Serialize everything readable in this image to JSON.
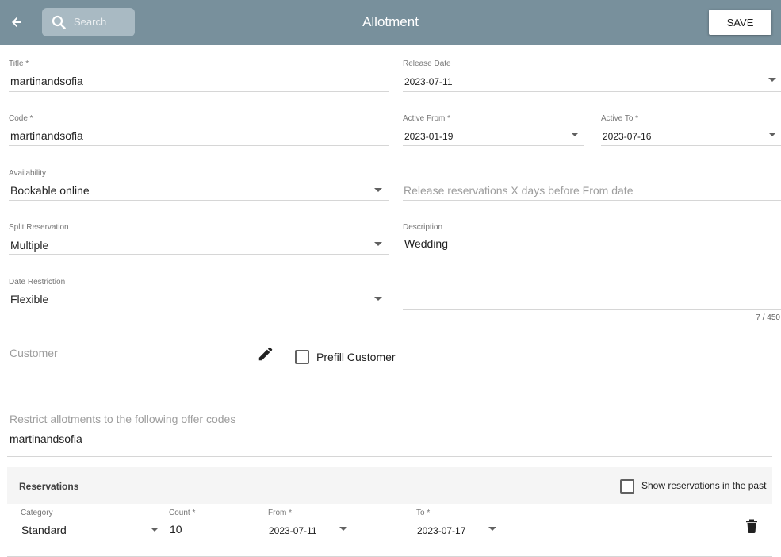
{
  "header": {
    "title": "Allotment",
    "search_placeholder": "Search",
    "save_label": "SAVE",
    "bar_color": "#78909c"
  },
  "form": {
    "title": {
      "label": "Title *",
      "value": "martinandsofia"
    },
    "release_date": {
      "label": "Release Date",
      "value": "2023-07-11"
    },
    "code": {
      "label": "Code *",
      "value": "martinandsofia"
    },
    "active_from": {
      "label": "Active From *",
      "value": "2023-01-19"
    },
    "active_to": {
      "label": "Active To *",
      "value": "2023-07-16"
    },
    "availability": {
      "label": "Availability",
      "value": "Bookable online"
    },
    "release_days": {
      "placeholder": "Release reservations X days before From date"
    },
    "split_reservation": {
      "label": "Split Reservation",
      "value": "Multiple"
    },
    "description": {
      "label": "Description",
      "value": "Wedding",
      "counter": "7 / 450"
    },
    "date_restriction": {
      "label": "Date Restriction",
      "value": "Flexible"
    },
    "customer": {
      "placeholder": "Customer"
    },
    "prefill_customer": {
      "label": "Prefill Customer",
      "checked": false
    },
    "offer_codes": {
      "placeholder": "Restrict allotments to the following offer codes",
      "value": "martinandsofia"
    }
  },
  "reservations": {
    "title": "Reservations",
    "show_past_label": "Show reservations in the past",
    "show_past_checked": false,
    "rows": [
      {
        "category_label": "Category",
        "category": "Standard",
        "count_label": "Count *",
        "count": "10",
        "from_label": "From *",
        "from": "2023-07-11",
        "to_label": "To *",
        "to": "2023-07-17"
      }
    ]
  },
  "icons": [
    "arrow-back-icon",
    "search-icon",
    "pencil-icon",
    "chevron-down-icon",
    "trash-icon"
  ]
}
